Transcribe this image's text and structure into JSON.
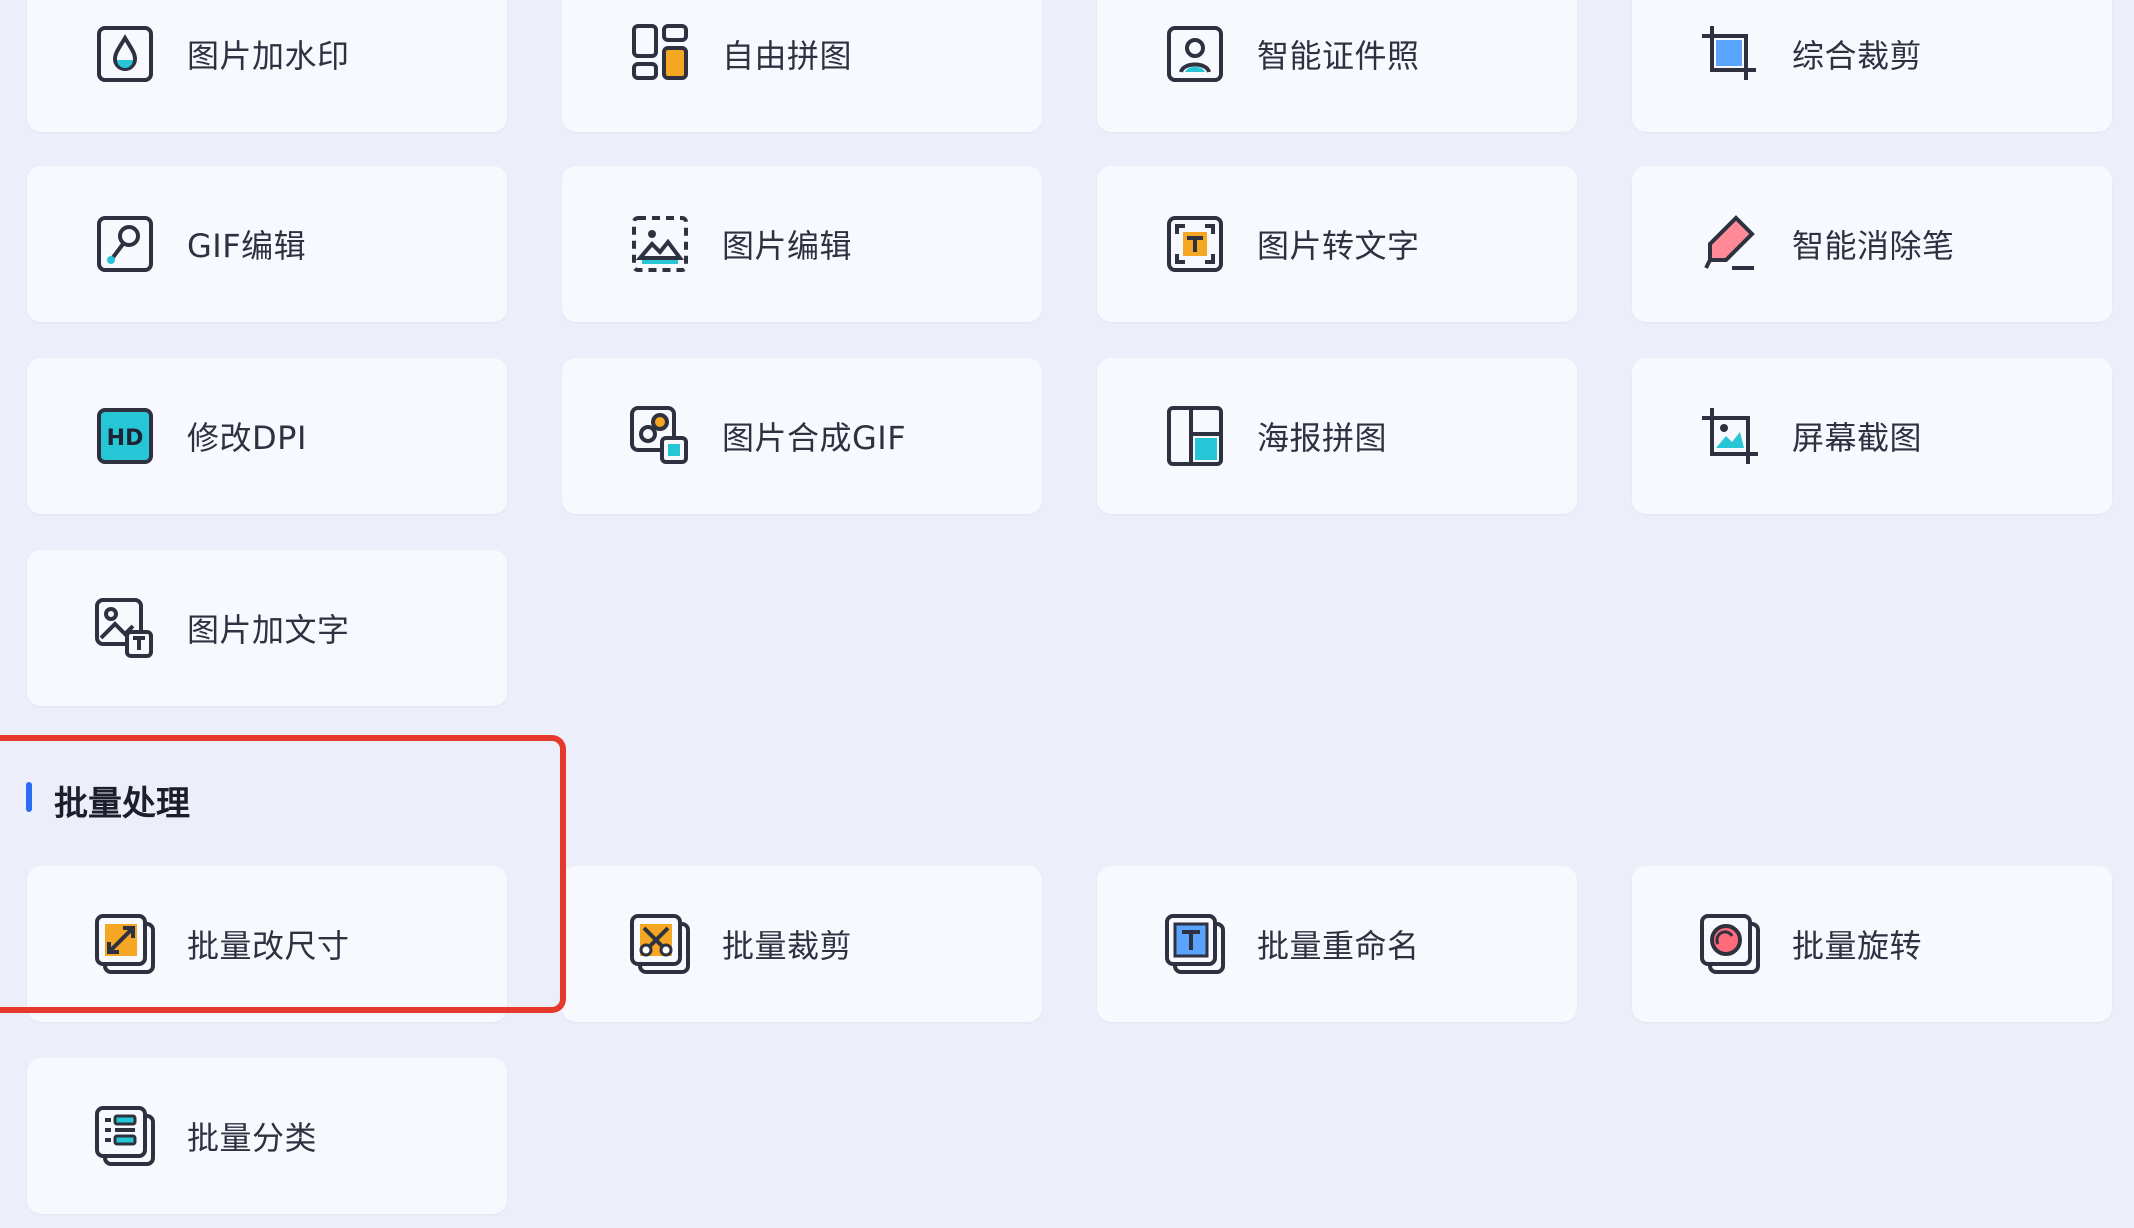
{
  "tools": {
    "watermark": "图片加水印",
    "free_collage": "自由拼图",
    "id_photo": "智能证件照",
    "crop": "综合裁剪",
    "gif_edit": "GIF编辑",
    "image_edit": "图片编辑",
    "ocr": "图片转文字",
    "eraser": "智能消除笔",
    "dpi": "修改DPI",
    "make_gif": "图片合成GIF",
    "poster": "海报拼图",
    "screenshot": "屏幕截图",
    "add_text": "图片加文字"
  },
  "batch": {
    "section_title": "批量处理",
    "resize": "批量改尺寸",
    "crop": "批量裁剪",
    "rename": "批量重命名",
    "rotate": "批量旋转",
    "classify": "批量分类"
  },
  "colors": {
    "accent": "#2b6cf6",
    "highlight": "#e5392b",
    "teal": "#27c6d6",
    "orange": "#f5a623",
    "pink": "#ff6b7a"
  }
}
